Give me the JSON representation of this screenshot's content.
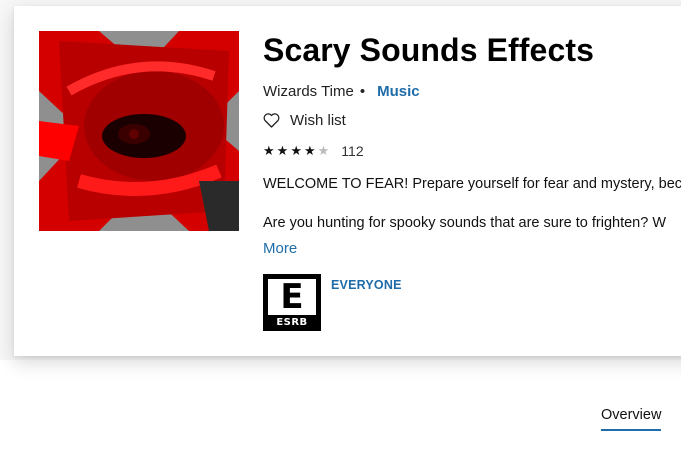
{
  "product": {
    "title": "Scary Sounds Effects",
    "publisher": "Wizards Time",
    "separator": "•",
    "category": "Music",
    "wishlist_label": "Wish list",
    "rating_stars": 4,
    "rating_max": 5,
    "rating_count": "112",
    "description_line1": "WELCOME TO FEAR! Prepare yourself for fear and mystery, beca",
    "description_line2": "Are you hunting for spooky sounds that are sure to frighten? W",
    "more_label": "More",
    "esrb": {
      "letter": "E",
      "label": "ESRB",
      "rating_text": "EVERYONE"
    }
  },
  "tabs": [
    {
      "label": "Overview",
      "active": true
    }
  ],
  "colors": {
    "accent": "#1f6ca8",
    "art_red": "#e00000",
    "art_gray": "#9a9a9a"
  }
}
